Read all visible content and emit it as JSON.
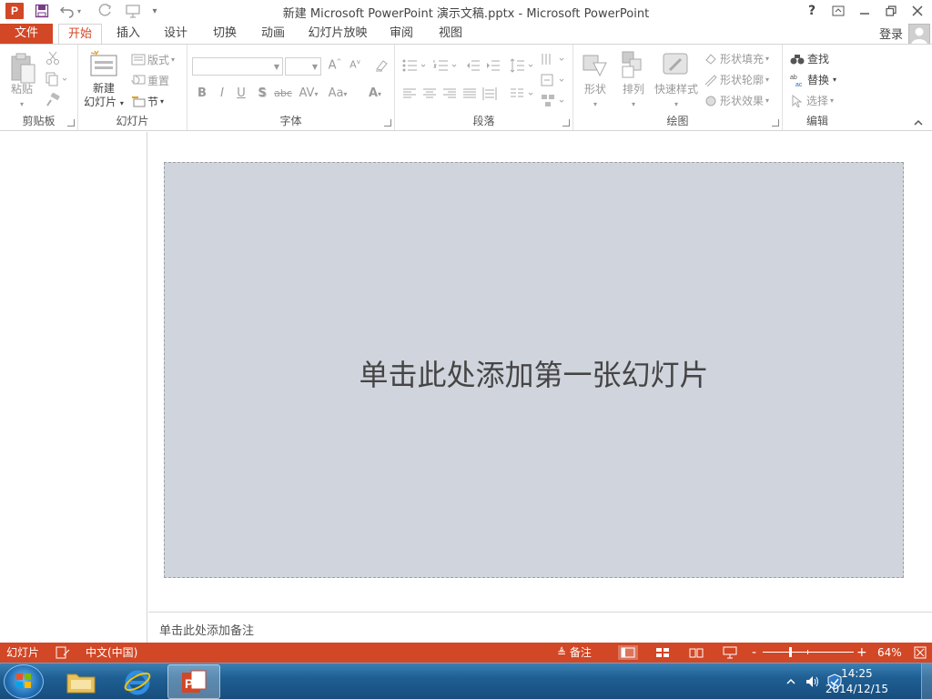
{
  "window": {
    "title": "新建 Microsoft PowerPoint 演示文稿.pptx - Microsoft PowerPoint",
    "logo_letter": "P"
  },
  "tabs": {
    "file": "文件",
    "items": [
      "开始",
      "插入",
      "设计",
      "切换",
      "动画",
      "幻灯片放映",
      "审阅",
      "视图"
    ],
    "active": "开始",
    "login": "登录"
  },
  "ribbon": {
    "clipboard": {
      "label": "剪贴板",
      "paste": "粘贴"
    },
    "slides": {
      "label": "幻灯片",
      "new_slide_1": "新建",
      "new_slide_2": "幻灯片",
      "layout": "版式",
      "reset": "重置",
      "section": "节"
    },
    "font": {
      "label": "字体",
      "bold": "B",
      "italic": "I",
      "underline": "U",
      "shadow": "S",
      "strike": "abc",
      "spacing": "AV",
      "case": "Aa",
      "color": "A",
      "grow": "A",
      "shrink": "A"
    },
    "paragraph": {
      "label": "段落"
    },
    "drawing": {
      "label": "绘图",
      "shapes": "形状",
      "arrange": "排列",
      "quick_styles": "快速样式",
      "fill": "形状填充",
      "outline": "形状轮廓",
      "effects": "形状效果"
    },
    "editing": {
      "label": "编辑",
      "find": "查找",
      "replace": "替换",
      "select": "选择"
    }
  },
  "slide": {
    "prompt": "单击此处添加第一张幻灯片"
  },
  "notes": {
    "placeholder": "单击此处添加备注"
  },
  "statusbar": {
    "slide": "幻灯片",
    "language": "中文(中国)",
    "notes": "备注",
    "zoom": "64%",
    "zoom_value": 64
  },
  "taskbar": {
    "time": "14:25",
    "date": "2014/12/15"
  },
  "colors": {
    "accent": "#d24726",
    "slide_bg": "#d0d4dc",
    "taskbar": "#1f5f93"
  }
}
